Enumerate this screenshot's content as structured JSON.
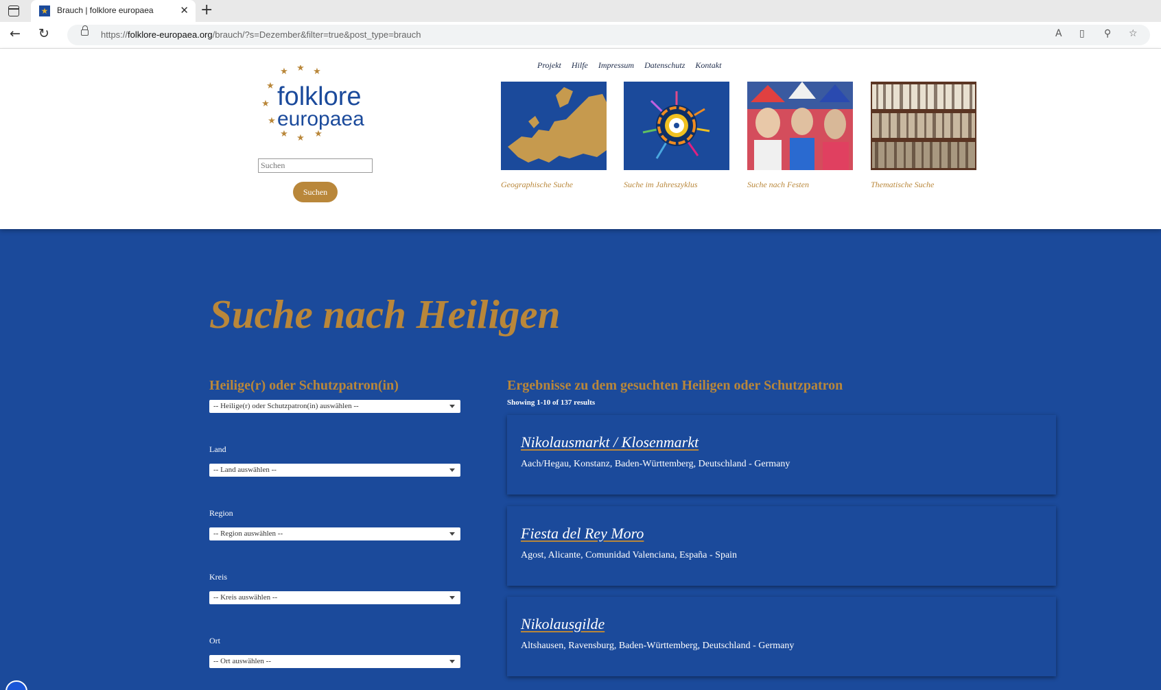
{
  "browser": {
    "tab_title": "Brauch | folklore europaea",
    "url_prefix": "https://",
    "url_domain": "folklore-europaea.org",
    "url_path": "/brauch/?s=Dezember&filter=true&post_type=brauch"
  },
  "header": {
    "logo_line1": "folklore",
    "logo_line2": "europaea",
    "search_placeholder": "Suchen",
    "search_button": "Suchen",
    "nav": [
      "Projekt",
      "Hilfe",
      "Impressum",
      "Datenschutz",
      "Kontakt"
    ],
    "tiles": [
      {
        "label": "Geographische Suche"
      },
      {
        "label": "Suche im Jahreszyklus"
      },
      {
        "label": "Suche nach Festen"
      },
      {
        "label": "Thematische Suche"
      }
    ]
  },
  "main": {
    "page_title": "Suche nach Heiligen",
    "filters": {
      "title": "Heilige(r) oder Schutzpatron(in)",
      "saint_select": "-- Heilige(r) oder Schutzpatron(in) auswählen --",
      "country_label": "Land",
      "country_select": "-- Land auswählen --",
      "region_label": "Region",
      "region_select": "-- Region auswählen --",
      "district_label": "Kreis",
      "district_select": "-- Kreis auswählen --",
      "place_label": "Ort",
      "place_select": "-- Ort auswählen --"
    },
    "results": {
      "title": "Ergebnisse zu dem gesuchten Heiligen oder Schutzpatron",
      "count": "Showing 1-10 of 137 results",
      "items": [
        {
          "title": "Nikolausmarkt / Klosenmarkt",
          "location": "Aach/Hegau, Konstanz, Baden-Württemberg, Deutschland - Germany"
        },
        {
          "title": "Fiesta del Rey Moro",
          "location": "Agost, Alicante, Comunidad Valenciana, España - Spain"
        },
        {
          "title": "Nikolausgilde",
          "location": "Altshausen, Ravensburg, Baden-Württemberg, Deutschland - Germany"
        }
      ]
    }
  },
  "colors": {
    "brand_blue": "#1b4a9b",
    "accent_gold": "#b9873a"
  }
}
